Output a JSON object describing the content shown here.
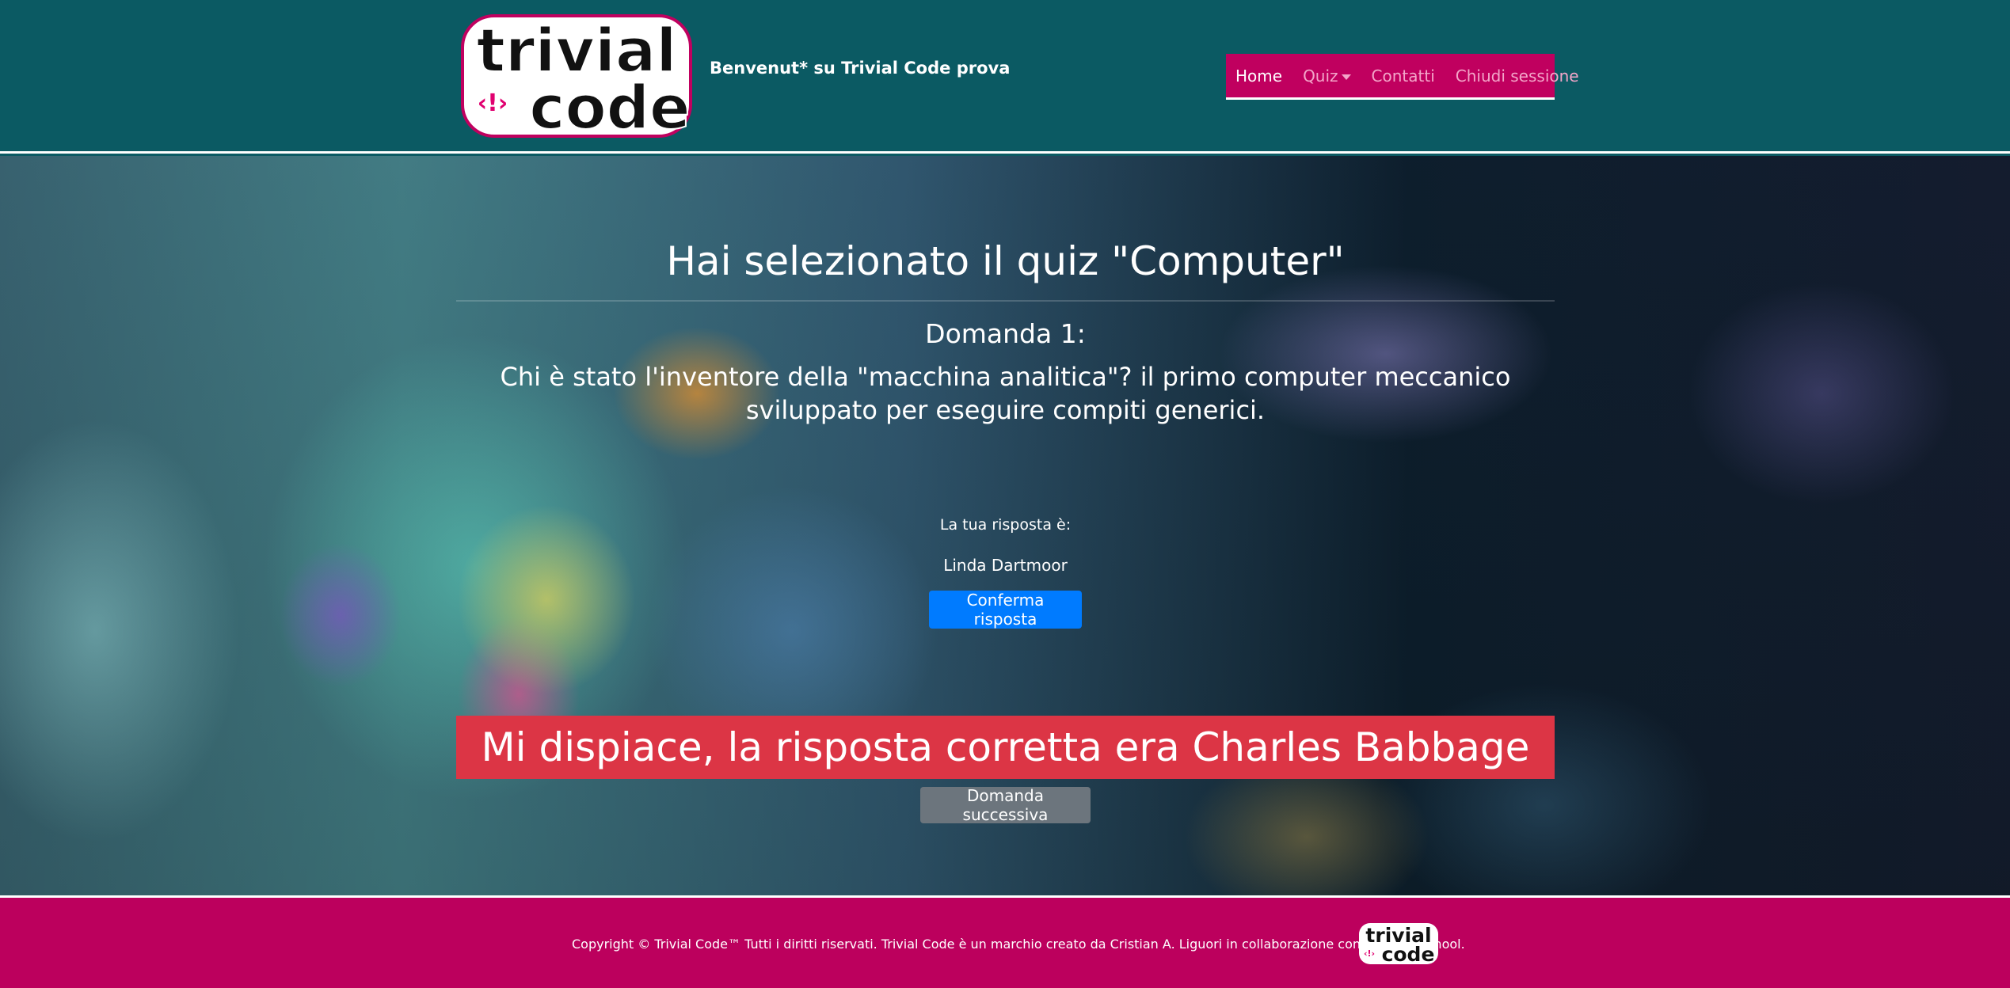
{
  "header": {
    "logo": {
      "line1": "trivial",
      "line2": "code",
      "mark": "<!>",
      "icon": "trivial-code-logo"
    },
    "welcome_text": "Benvenut* su Trivial Code prova"
  },
  "nav": {
    "items": [
      {
        "label": "Home",
        "active": true
      },
      {
        "label": "Quiz",
        "dropdown": true
      },
      {
        "label": "Contatti"
      },
      {
        "label": "Chiudi sessione"
      }
    ]
  },
  "quiz": {
    "title": "Hai selezionato il quiz \"Computer\"",
    "question_number": "Domanda 1:",
    "question_text": "Chi è stato l'inventore della \"macchina analitica\"? il primo computer meccanico sviluppato per eseguire compiti generici.",
    "answer_label": "La tua risposta è:",
    "answer_value": "Linda Dartmoor",
    "confirm_button": "Conferma risposta",
    "result_message": "Mi dispiace, la risposta corretta era Charles Babbage",
    "next_button": "Domanda successiva"
  },
  "footer": {
    "copyright": "Copyright © Trivial Code™ Tutti i diritti riservati. Trivial Code è un marchio creato da Cristian A. Liguori in collaborazione con Epicode School."
  },
  "colors": {
    "header_bg": "#0b5a63",
    "accent_pink": "#c0005f",
    "primary_button": "#007bff",
    "danger": "#dc3545",
    "secondary_button": "#6c757d"
  }
}
